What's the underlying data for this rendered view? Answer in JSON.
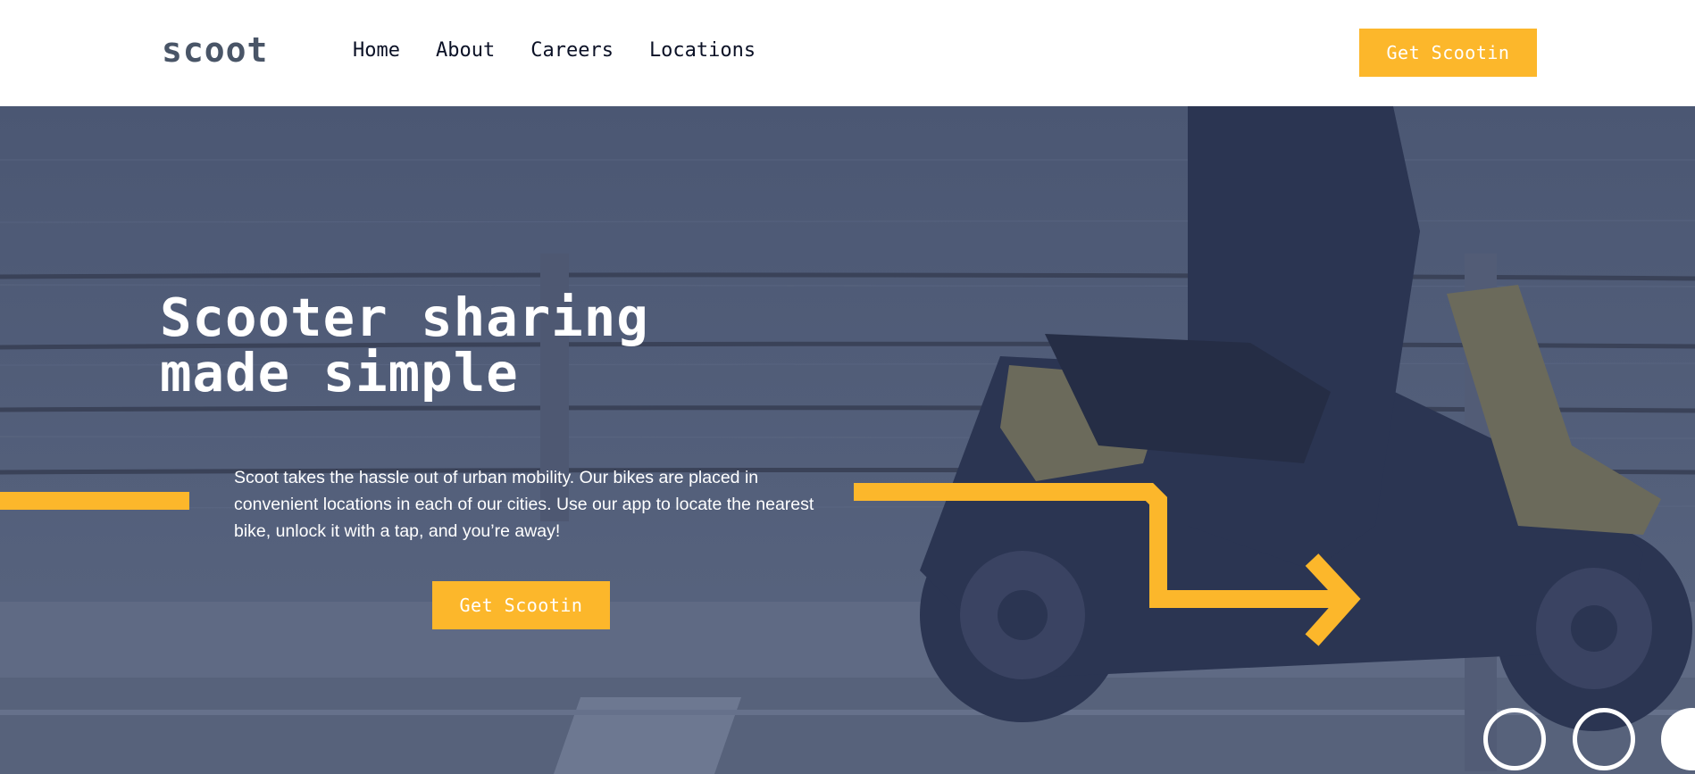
{
  "header": {
    "logo": "scoot",
    "nav": [
      {
        "label": "Home"
      },
      {
        "label": "About"
      },
      {
        "label": "Careers"
      },
      {
        "label": "Locations"
      }
    ],
    "cta_label": "Get Scootin"
  },
  "hero": {
    "title_line1": "Scooter sharing",
    "title_line2": "made simple",
    "description": "Scoot takes the hassle out of urban mobility. Our bikes are placed in convenient locations in each of our cities. Use our app to locate the nearest bike, unlock it with a tap, and you’re away!",
    "cta_label": "Get Scootin"
  },
  "colors": {
    "accent": "#fcb72b",
    "navy": "#495567",
    "dark_navy": "#0b1126",
    "hero_overlay": "#515e7c"
  }
}
